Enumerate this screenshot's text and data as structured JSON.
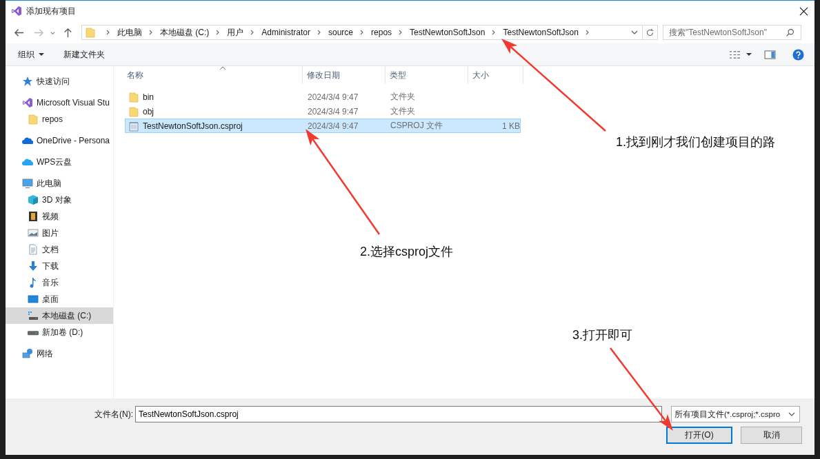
{
  "window": {
    "title": "添加现有项目"
  },
  "address": {
    "segments": [
      "此电脑",
      "本地磁盘 (C:)",
      "用户",
      "Administrator",
      "source",
      "repos",
      "TestNewtonSoftJson",
      "TestNewtonSoftJson"
    ]
  },
  "search": {
    "placeholder": "搜索\"TestNewtonSoftJson\""
  },
  "toolbar": {
    "buttons": [
      {
        "label": "组织",
        "menu": true
      },
      {
        "label": "新建文件夹",
        "menu": false
      }
    ]
  },
  "sidebar": {
    "items": [
      {
        "label": "快速访问",
        "kind": "star",
        "selected": false
      },
      {
        "label": "Microsoft Visual Stu",
        "kind": "vs",
        "selected": false,
        "children": [
          {
            "label": "repos",
            "kind": "folder",
            "selected": false
          }
        ]
      },
      {
        "label": "OneDrive - Persona",
        "kind": "cloud",
        "selected": false
      },
      {
        "label": "WPS云盘",
        "kind": "wps",
        "selected": false
      },
      {
        "label": "此电脑",
        "kind": "pc",
        "selected": false,
        "children": [
          {
            "label": "3D 对象",
            "kind": "cube",
            "selected": false
          },
          {
            "label": "视频",
            "kind": "film",
            "selected": false
          },
          {
            "label": "图片",
            "kind": "image",
            "selected": false
          },
          {
            "label": "文档",
            "kind": "doc",
            "selected": false
          },
          {
            "label": "下载",
            "kind": "download",
            "selected": false
          },
          {
            "label": "音乐",
            "kind": "music",
            "selected": false
          },
          {
            "label": "桌面",
            "kind": "desktop",
            "selected": false
          },
          {
            "label": "本地磁盘 (C:)",
            "kind": "drive-c",
            "selected": true
          },
          {
            "label": "新加卷 (D:)",
            "kind": "drive",
            "selected": false
          }
        ]
      },
      {
        "label": "网络",
        "kind": "network",
        "selected": false
      }
    ]
  },
  "table": {
    "columns": [
      "名称",
      "修改日期",
      "类型",
      "大小"
    ],
    "rows": [
      {
        "name": "bin",
        "kind": "folder",
        "modified": "2024/3/4 9:47",
        "type": "文件夹",
        "selected": false
      },
      {
        "name": "obj",
        "kind": "folder",
        "modified": "2024/3/4 9:47",
        "type": "文件夹",
        "selected": false
      },
      {
        "name": "TestNewtonSoftJson.csproj",
        "kind": "file",
        "modified": "2024/3/4 9:47",
        "type": "CSPROJ 文件",
        "size": "1 KB",
        "selected": true
      }
    ]
  },
  "file_name": {
    "label": "文件名(N):",
    "value": "TestNewtonSoftJson.csproj"
  },
  "file_type": {
    "value": "所有项目文件(*.csproj;*.cspro"
  },
  "buttons": [
    {
      "label": "打开(O)",
      "default": true
    },
    {
      "label": "取消",
      "default": false
    }
  ],
  "annotations": [
    {
      "text": "1.找到刚才我们创建项目的路"
    },
    {
      "text": "2.选择csproj文件"
    },
    {
      "text": "3.打开即可"
    }
  ]
}
